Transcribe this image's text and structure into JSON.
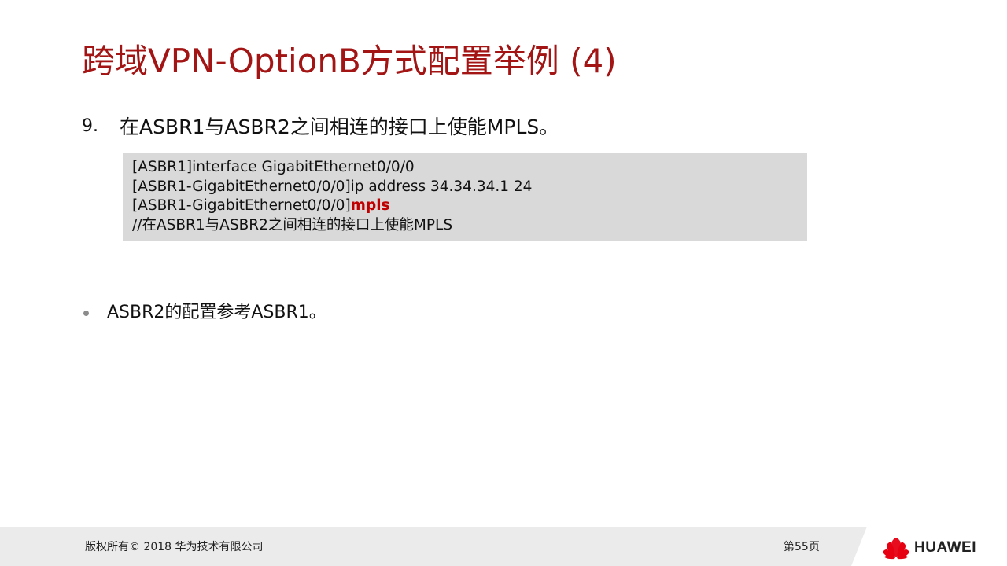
{
  "slide": {
    "title": "跨域VPN-OptionB方式配置举例 (4)",
    "step": {
      "number": "9.",
      "text": "在ASBR1与ASBR2之间相连的接口上使能MPLS。"
    },
    "code": {
      "line1": "[ASBR1]interface GigabitEthernet0/0/0",
      "line2": "[ASBR1-GigabitEthernet0/0/0]ip  address 34.34.34.1  24",
      "line3_prefix": "[ASBR1-GigabitEthernet0/0/0]",
      "line3_keyword": "mpls",
      "line4": "//在ASBR1与ASBR2之间相连的接口上使能MPLS"
    },
    "bullet": {
      "text": "ASBR2的配置参考ASBR1。"
    }
  },
  "footer": {
    "copyright": "版权所有© 2018 华为技术有限公司",
    "page": "第55页",
    "brand": "HUAWEI"
  },
  "colors": {
    "title": "#a31414",
    "keyword": "#c00000",
    "code_background": "#d9d9d9",
    "footer_background": "#ebebeb",
    "logo_red": "#e60012"
  },
  "icons": {
    "brand_logo": "huawei-petal-logo-icon",
    "bullet": "bullet-dot-icon"
  }
}
